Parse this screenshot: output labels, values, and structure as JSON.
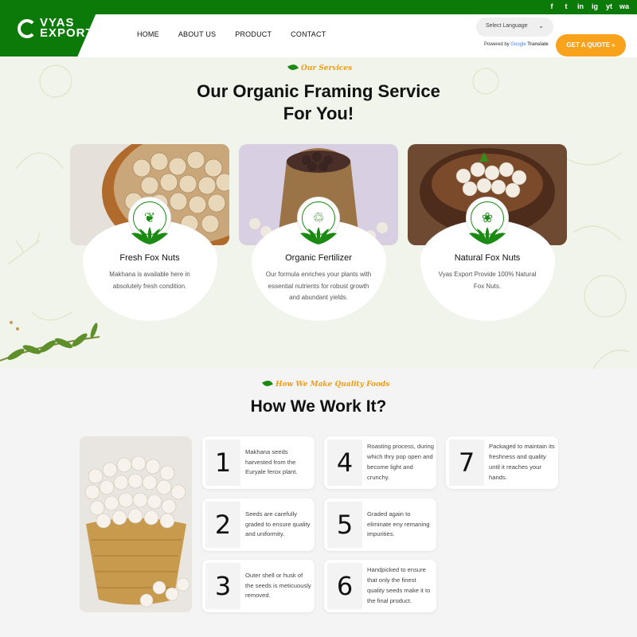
{
  "brand": {
    "logo_line1": "VYAS",
    "logo_line2": "EXPORT"
  },
  "social": [
    "f",
    "t",
    "in",
    "ig",
    "yt",
    "wa"
  ],
  "nav": [
    "HOME",
    "ABOUT US",
    "PRODUCT",
    "CONTACT"
  ],
  "language": {
    "label": "Select Language",
    "powered_by": "Powered by",
    "google": "Google",
    "translate": "Translate"
  },
  "cta": {
    "label": "GET A QUOTE »"
  },
  "services": {
    "eyebrow": "Our Services",
    "title_line1": "Our Organic Framing Service",
    "title_line2": "For You!",
    "cards": [
      {
        "title": "Fresh Fox Nuts",
        "desc": "Makhana is available here in absolutely fresh condition.",
        "icon": "vegetable-icon"
      },
      {
        "title": "Organic Fertilizer",
        "desc": "Our formula enriches your plants with essential nutrients for robust growth and abundant yields.",
        "icon": "fertilizer-bag-icon"
      },
      {
        "title": "Natural Fox Nuts",
        "desc": "Vyas Export Provide 100% Natural Fox Nuts.",
        "icon": "fruit-basket-icon"
      }
    ]
  },
  "process": {
    "eyebrow": "How We Make Quality Foods",
    "title": "How We Work It?",
    "steps": [
      {
        "num": "1",
        "text": "Makhana seeds harvested from the Euryale ferox plant."
      },
      {
        "num": "2",
        "text": "Seeds are carefully graded to ensure quality and uniformity."
      },
      {
        "num": "3",
        "text": "Outer shell or husk of the seeds is meticuously removed."
      },
      {
        "num": "4",
        "text": "Roasting process, during which thry pop open and become light and crunchy."
      },
      {
        "num": "5",
        "text": "Graded again to eliminate eny remaning impurities."
      },
      {
        "num": "6",
        "text": "Handpicked to ensure that only the finest quality seeds make it to the final product."
      },
      {
        "num": "7",
        "text": "Packaged to maintain its freshness and quality until it reaches your hands."
      }
    ]
  },
  "colors": {
    "brand_green": "#0b7a08",
    "accent_orange": "#f9a21b",
    "section_bg": "#f1f4ea"
  }
}
